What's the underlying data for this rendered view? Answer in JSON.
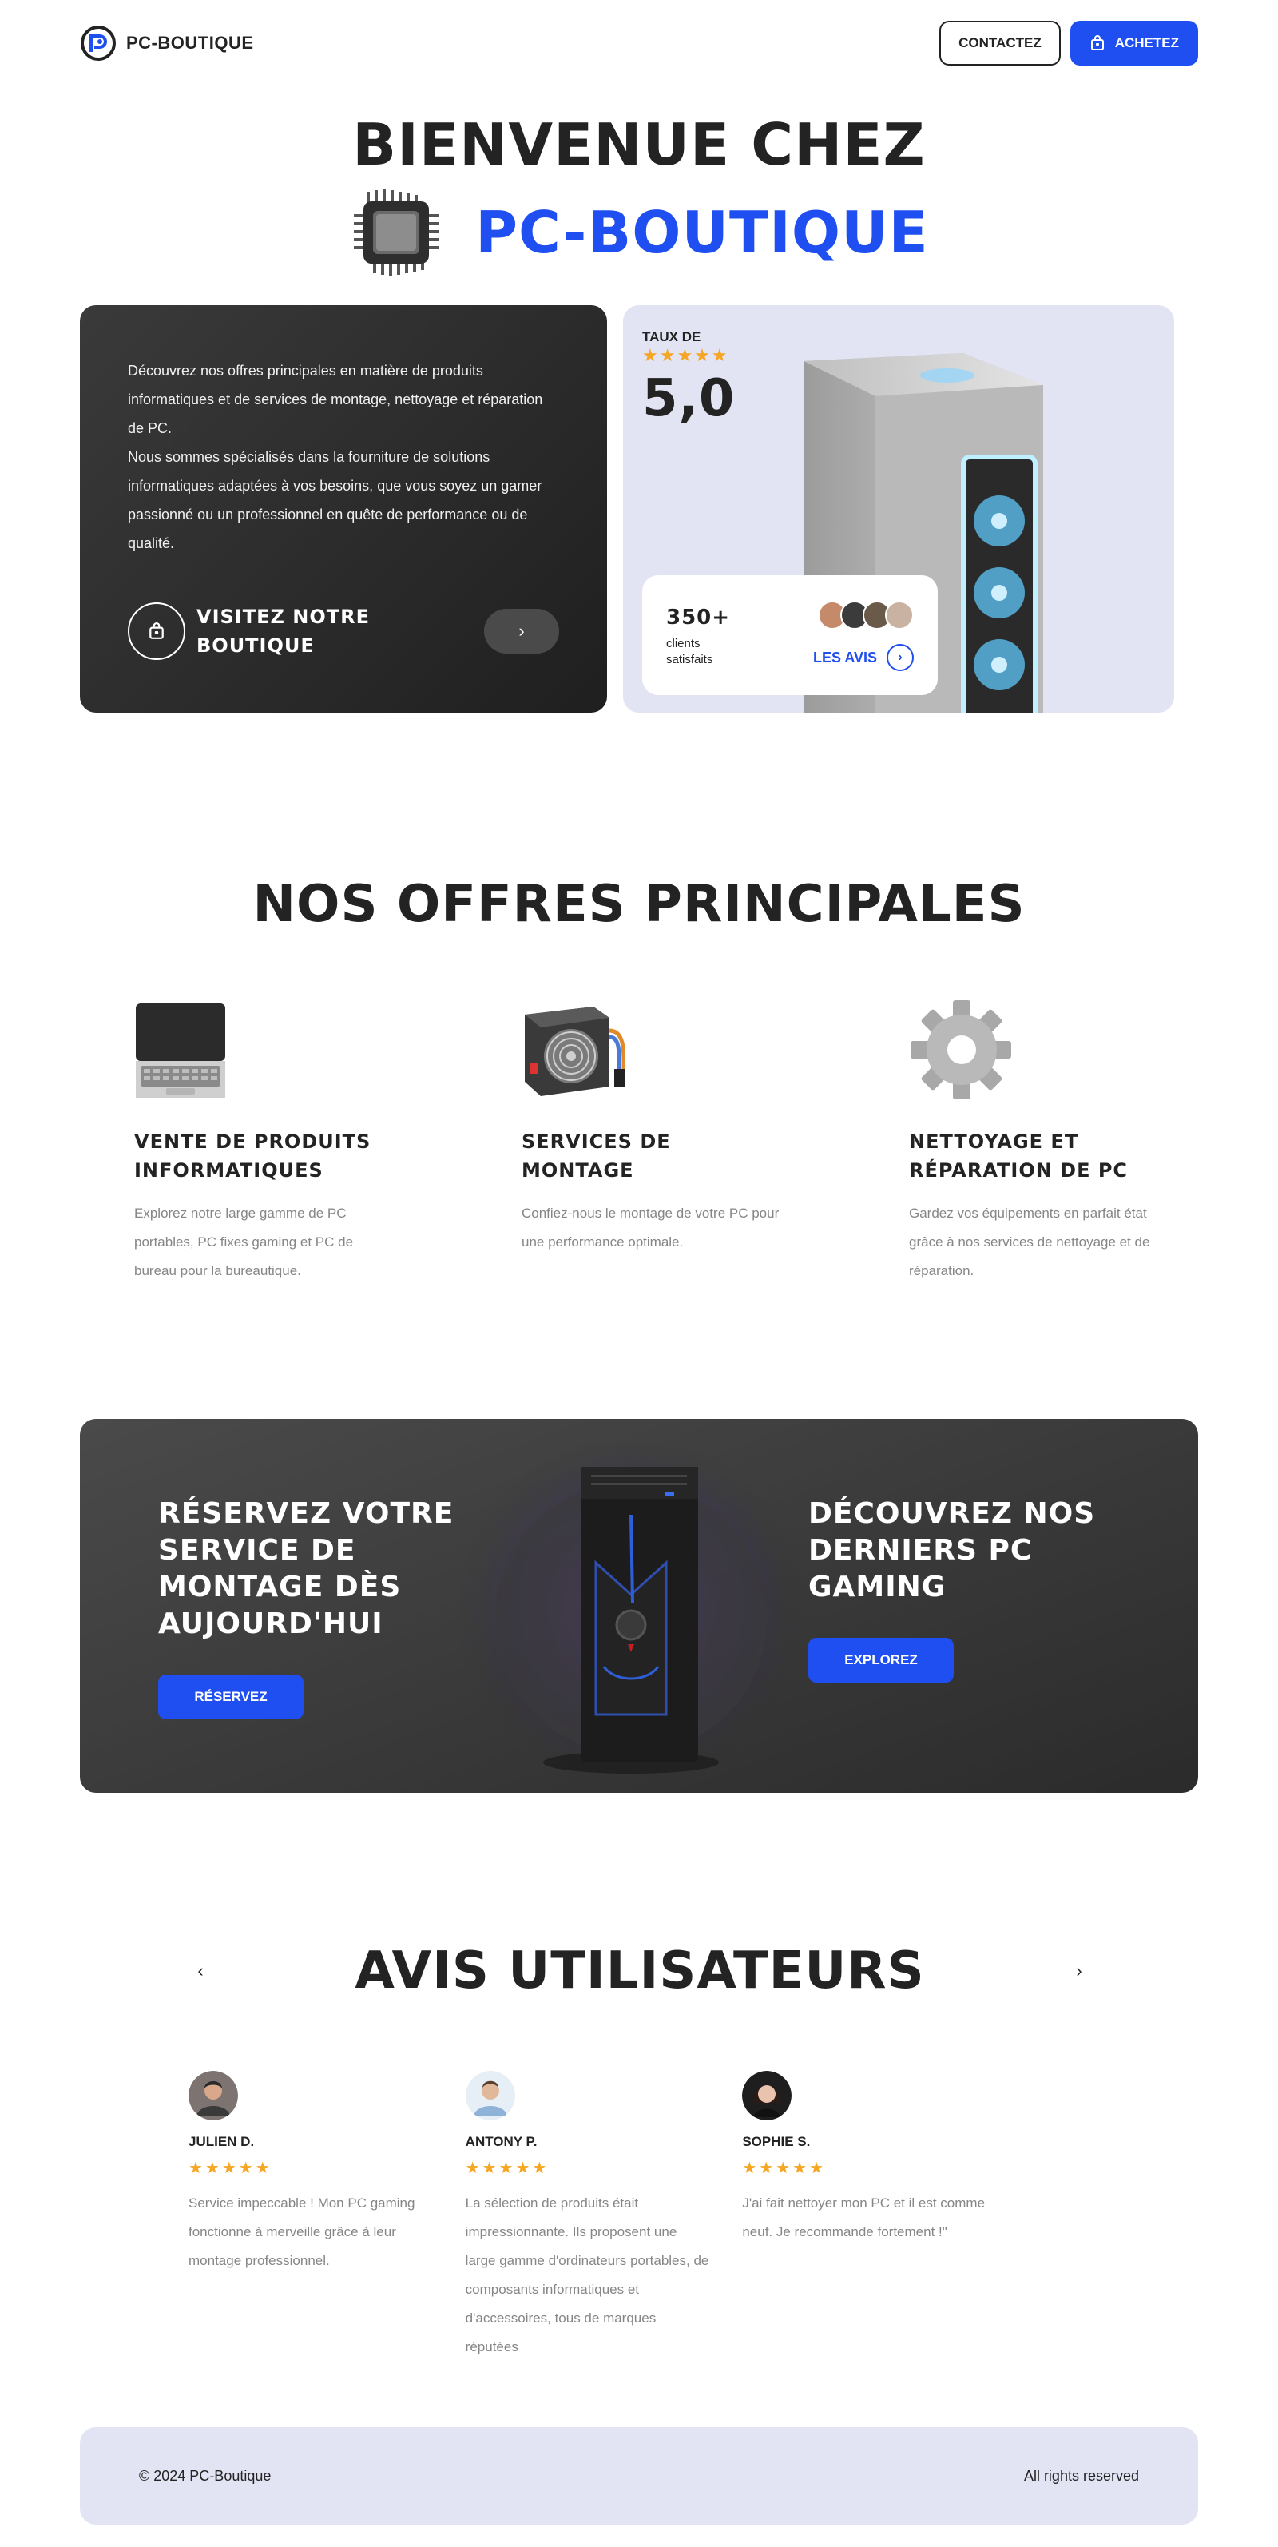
{
  "header": {
    "brand_name": "PC-BOUTIQUE",
    "contact_label": "CONTACTEZ",
    "buy_label": "ACHETEZ"
  },
  "hero": {
    "title_line1": "BIENVENUE CHEZ",
    "title_line2": "PC-BOUTIQUE",
    "description_p1": "Découvrez nos offres principales en matière de produits informatiques et de services de montage, nettoyage et réparation de PC.",
    "description_p2": "Nous sommes spécialisés dans la fourniture de solutions informatiques adaptées à vos besoins, que vous soyez un gamer passionné ou un professionnel en quête de performance ou de qualité.",
    "visit_label": "VISITEZ NOTRE BOUTIQUE",
    "rate_label": "TAUX DE",
    "rate_stars": "★★★★★",
    "rate_value": "5,0",
    "clients_count": "350+",
    "clients_label": "clients satisfaits",
    "reviews_link": "LES AVIS"
  },
  "offers": {
    "title": "NOS OFFRES PRINCIPALES",
    "items": [
      {
        "icon": "laptop-icon",
        "title": "VENTE DE PRODUITS INFORMATIQUES",
        "desc": "Explorez notre large gamme de PC portables, PC fixes gaming et PC de bureau pour la bureautique."
      },
      {
        "icon": "power-supply-icon",
        "title": "SERVICES DE MONTAGE",
        "desc": "Confiez-nous le montage de votre PC pour une performance optimale."
      },
      {
        "icon": "gear-icon",
        "title": "NETTOYAGE ET RÉPARATION DE PC",
        "desc": "Gardez vos équipements en parfait état grâce à nos services de nettoyage et de réparation."
      }
    ]
  },
  "banner": {
    "left_title": "RÉSERVEZ VOTRE SERVICE DE MONTAGE DÈS AUJOURD'HUI",
    "left_button": "RÉSERVEZ",
    "right_title": "DÉCOUVREZ NOS DERNIERS PC GAMING",
    "right_button": "EXPLOREZ"
  },
  "reviews": {
    "title": "AVIS UTILISATEURS",
    "prev": "‹",
    "next": "›",
    "items": [
      {
        "name": "JULIEN D.",
        "stars": "★★★★★",
        "text": "Service impeccable ! Mon PC gaming fonctionne à merveille grâce à leur montage professionnel."
      },
      {
        "name": "ANTONY P.",
        "stars": "★★★★★",
        "text": "La sélection de produits était impressionnante. Ils proposent une large gamme d'ordinateurs portables, de composants informatiques et d'accessoires, tous de marques réputées"
      },
      {
        "name": "SOPHIE S.",
        "stars": "★★★★★",
        "text": "J'ai fait nettoyer mon PC et il est comme neuf. Je recommande fortement !\""
      }
    ]
  },
  "footer": {
    "copyright": "© 2024 PC-Boutique",
    "rights": "All rights reserved"
  },
  "colors": {
    "accent": "#1f4ff0",
    "dark": "#232323",
    "lavender": "#e2e3f3",
    "star": "#f5a623"
  }
}
